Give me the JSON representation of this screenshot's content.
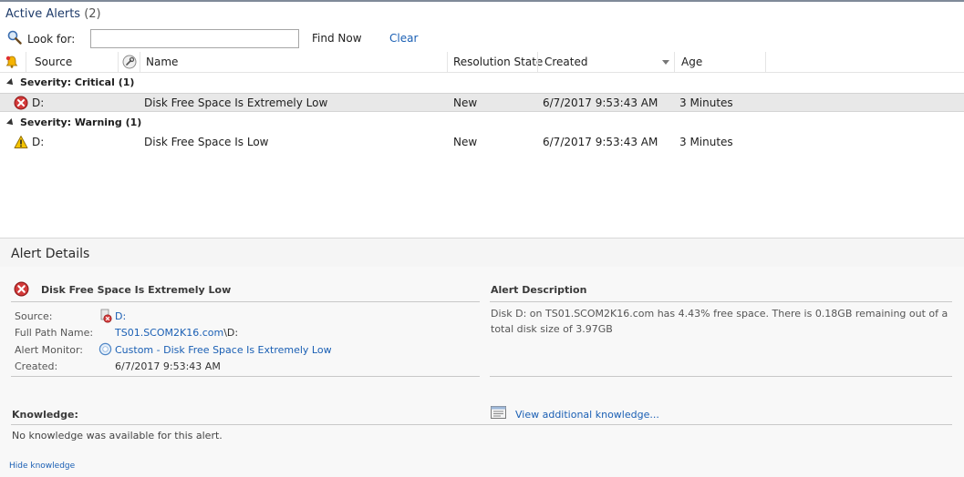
{
  "header": {
    "title": "Active Alerts",
    "count": "(2)"
  },
  "search": {
    "look_for_label": "Look for:",
    "value": "",
    "placeholder": "",
    "find_now": "Find Now",
    "clear": "Clear"
  },
  "columns": {
    "source": "Source",
    "name": "Name",
    "resolution_state": "Resolution State",
    "created": "Created",
    "age": "Age"
  },
  "groups": [
    {
      "label": "Severity: Critical (1)",
      "rows": [
        {
          "severity": "critical",
          "source": "D:",
          "name": "Disk Free Space Is Extremely Low",
          "resolution_state": "New",
          "created": "6/7/2017 9:53:43 AM",
          "age": "3 Minutes"
        }
      ]
    },
    {
      "label": "Severity: Warning (1)",
      "rows": [
        {
          "severity": "warning",
          "source": "D:",
          "name": "Disk Free Space Is Low",
          "resolution_state": "New",
          "created": "6/7/2017 9:53:43 AM",
          "age": "3 Minutes"
        }
      ]
    }
  ],
  "details": {
    "title": "Alert Details",
    "alert_name": "Disk Free Space Is Extremely Low",
    "source_label": "Source:",
    "source_value": "D:",
    "full_path_label": "Full Path Name:",
    "full_path_link": "TS01.SCOM2K16.com",
    "full_path_rest": "\\D:",
    "monitor_label": "Alert Monitor:",
    "monitor_value": "Custom - Disk Free Space Is Extremely Low",
    "created_label": "Created:",
    "created_value": "6/7/2017 9:53:43 AM",
    "description_heading": "Alert Description",
    "description": "Disk D: on TS01.SCOM2K16.com has 4.43% free space. There is 0.18GB remaining out of a total disk size of 3.97GB",
    "knowledge_heading": "Knowledge:",
    "knowledge_text": "No knowledge was available for this alert.",
    "view_knowledge": "View additional knowledge...",
    "hide_knowledge": "Hide knowledge"
  },
  "colors": {
    "link": "#1a5fb4",
    "critical": "#c0282d",
    "warning": "#f2c200",
    "selected_row": "#e8e8e8"
  }
}
